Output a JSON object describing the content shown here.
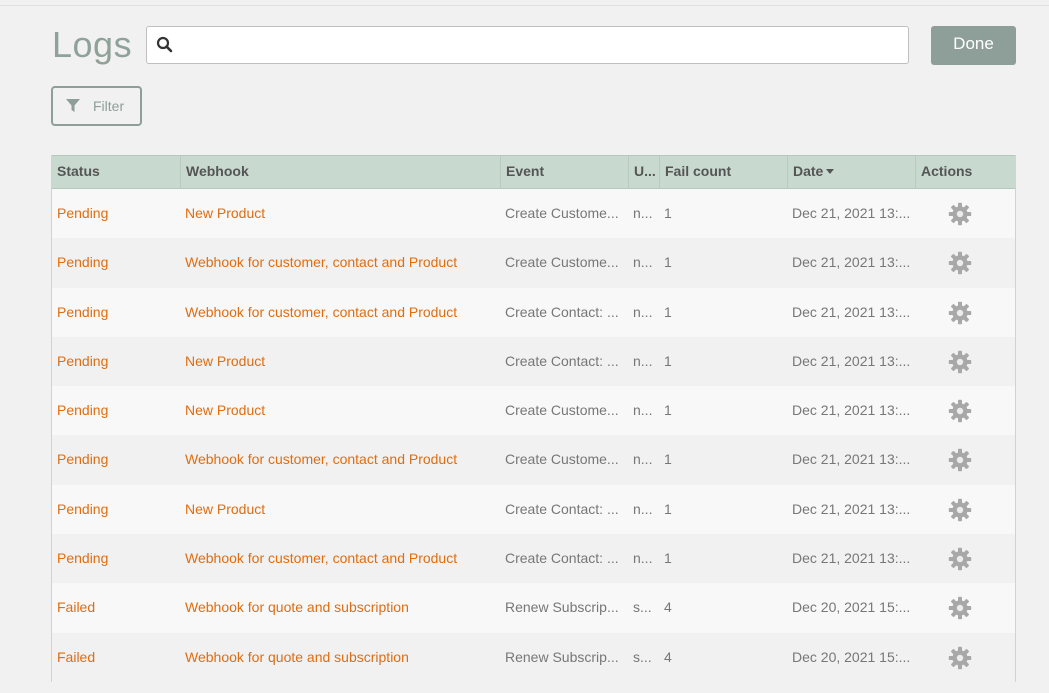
{
  "header": {
    "title": "Logs",
    "search_value": "",
    "search_placeholder": "",
    "done_label": "Done",
    "filter_label": "Filter"
  },
  "table": {
    "columns": [
      "Status",
      "Webhook",
      "Event",
      "U...",
      "Fail count",
      "Date",
      "Actions"
    ],
    "sorted_column": "Date",
    "sort_direction": "desc",
    "rows": [
      {
        "status": "Pending",
        "webhook": "New Product",
        "event": "Create Custome...",
        "u": "n...",
        "fail": "1",
        "date": "Dec 21, 2021 13:..."
      },
      {
        "status": "Pending",
        "webhook": "Webhook for customer, contact and Product",
        "event": "Create Custome...",
        "u": "n...",
        "fail": "1",
        "date": "Dec 21, 2021 13:..."
      },
      {
        "status": "Pending",
        "webhook": "Webhook for customer, contact and Product",
        "event": "Create Contact: ...",
        "u": "n...",
        "fail": "1",
        "date": "Dec 21, 2021 13:..."
      },
      {
        "status": "Pending",
        "webhook": "New Product",
        "event": "Create Contact: ...",
        "u": "n...",
        "fail": "1",
        "date": "Dec 21, 2021 13:..."
      },
      {
        "status": "Pending",
        "webhook": "New Product",
        "event": "Create Custome...",
        "u": "n...",
        "fail": "1",
        "date": "Dec 21, 2021 13:..."
      },
      {
        "status": "Pending",
        "webhook": "Webhook for customer, contact and Product",
        "event": "Create Custome...",
        "u": "n...",
        "fail": "1",
        "date": "Dec 21, 2021 13:..."
      },
      {
        "status": "Pending",
        "webhook": "New Product",
        "event": "Create Contact: ...",
        "u": "n...",
        "fail": "1",
        "date": "Dec 21, 2021 13:..."
      },
      {
        "status": "Pending",
        "webhook": "Webhook for customer, contact and Product",
        "event": "Create Contact: ...",
        "u": "n...",
        "fail": "1",
        "date": "Dec 21, 2021 13:..."
      },
      {
        "status": "Failed",
        "webhook": "Webhook for quote and subscription",
        "event": "Renew Subscrip...",
        "u": "s...",
        "fail": "4",
        "date": "Dec 20, 2021 15:..."
      },
      {
        "status": "Failed",
        "webhook": "Webhook for quote and subscription",
        "event": "Renew Subscrip...",
        "u": "s...",
        "fail": "4",
        "date": "Dec 20, 2021 15:..."
      }
    ]
  },
  "colors": {
    "accent_orange": "#e06d10",
    "header_green": "#c8d9cf",
    "button_gray_green": "#8d9f98",
    "gear_gray": "#a8a8a8"
  },
  "icons": {
    "search": "search-icon",
    "filter": "filter-icon",
    "actions": "gear-icon"
  }
}
